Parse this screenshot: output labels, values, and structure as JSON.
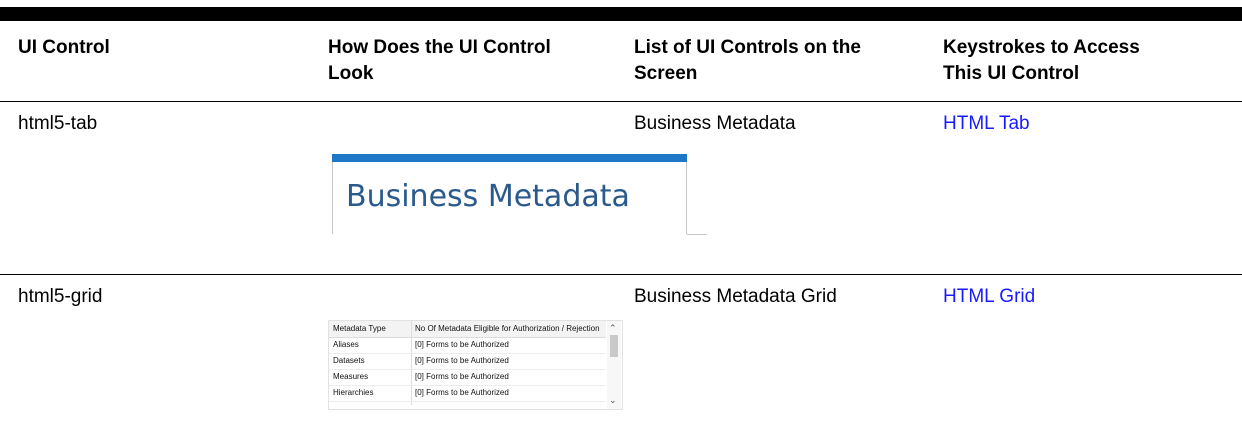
{
  "table": {
    "headers": [
      [
        "UI Control",
        ""
      ],
      [
        "How Does the UI Control",
        "Look"
      ],
      [
        "List of UI Controls on the",
        "Screen"
      ],
      [
        "Keystrokes to Access",
        "This UI Control"
      ]
    ],
    "rows": [
      {
        "control": "html5-tab",
        "screen_control": "Business Metadata",
        "keystroke_link": "HTML Tab",
        "image": {
          "tab_label": "Business Metadata",
          "tab_color": "#1f77c8"
        }
      },
      {
        "control": "html5-grid",
        "screen_control": "Business Metadata Grid",
        "keystroke_link": "HTML Grid",
        "image": {
          "columns": [
            "Metadata Type",
            "No Of Metadata Eligible for Authorization / Rejection"
          ],
          "rows": [
            [
              "Aliases",
              "[0] Forms to be Authorized"
            ],
            [
              "Datasets",
              "[0] Forms to be Authorized"
            ],
            [
              "Measures",
              "[0] Forms to be Authorized"
            ],
            [
              "Hierarchies",
              "[0] Forms to be Authorized"
            ]
          ]
        }
      }
    ]
  },
  "colors": {
    "link": "#1a1aff",
    "tab_accent": "#1f77c8",
    "tab_text": "#2a5a8c"
  },
  "icons": {
    "scroll_up": "chevron-up-icon",
    "scroll_down": "chevron-down-icon"
  }
}
